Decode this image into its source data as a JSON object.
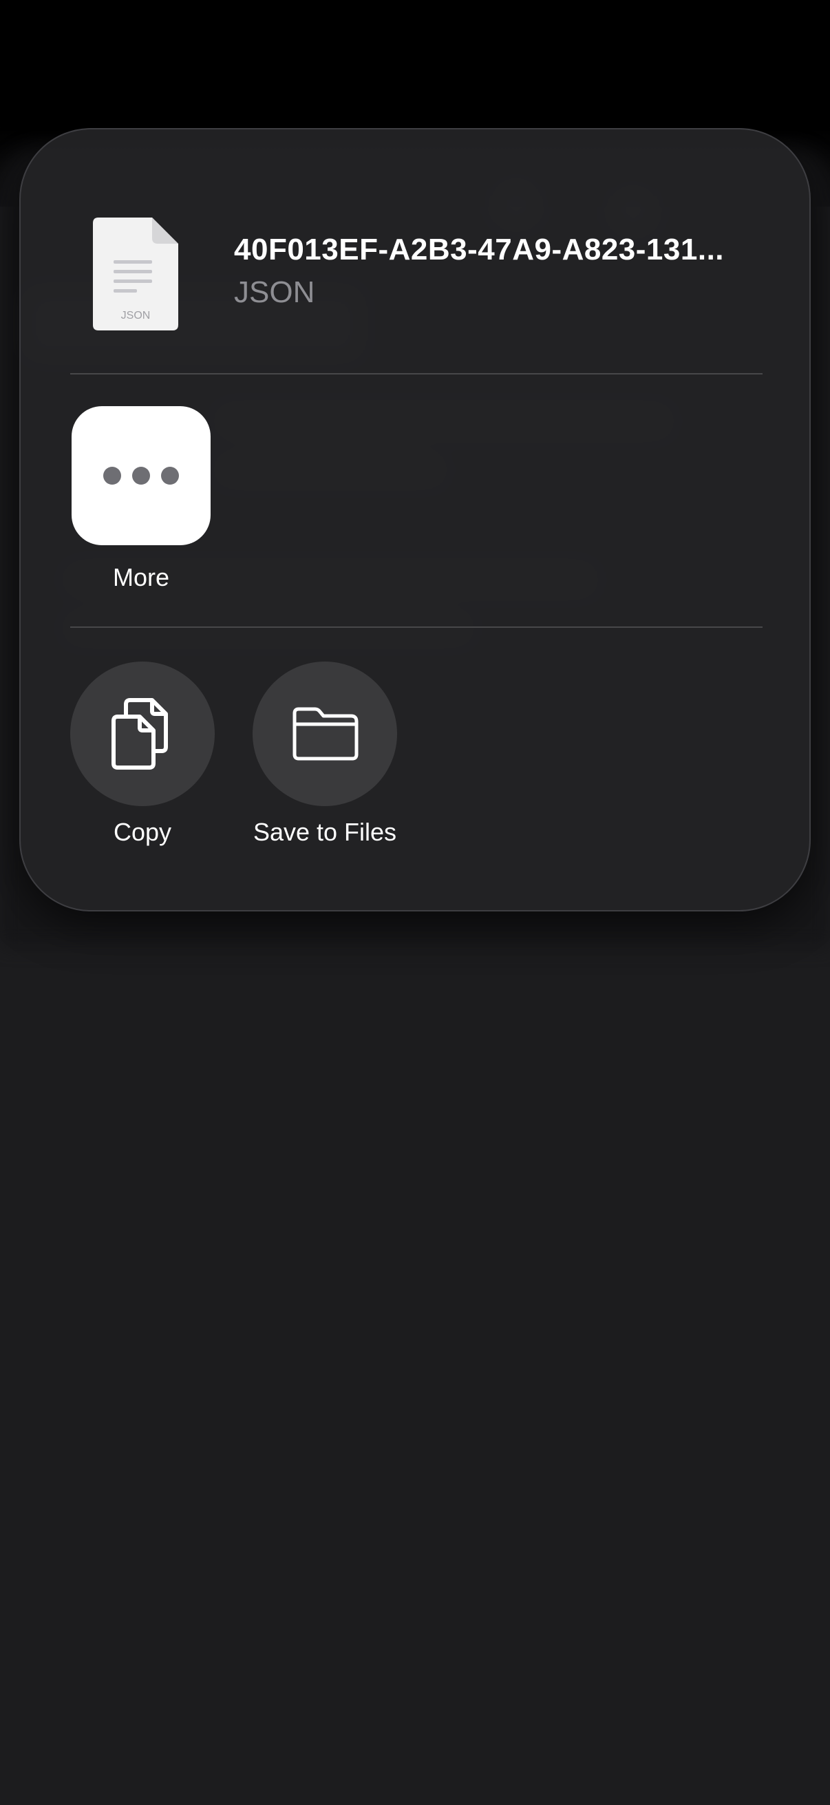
{
  "file": {
    "name": "40F013EF-A2B3-47A9-A823-131...",
    "type": "JSON",
    "thumbnail_label": "JSON"
  },
  "apps": [
    {
      "label": "More",
      "icon": "more-icon"
    }
  ],
  "actions": [
    {
      "label": "Copy",
      "icon": "copy-icon"
    },
    {
      "label": "Save to Files",
      "icon": "folder-icon"
    }
  ],
  "colors": {
    "sheet_background": "#242426",
    "action_circle": "#3a3a3c",
    "secondary_text": "#8e8e93"
  }
}
